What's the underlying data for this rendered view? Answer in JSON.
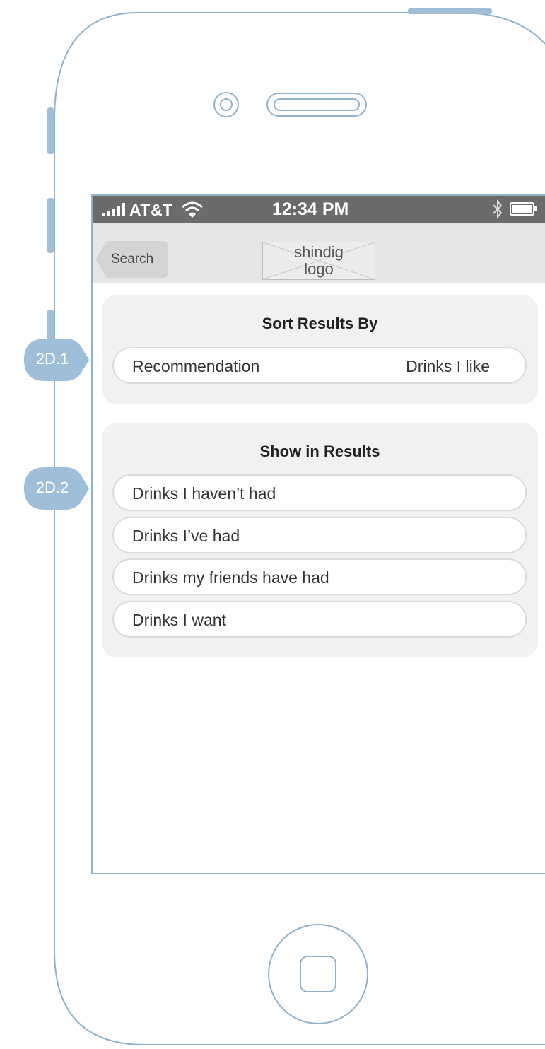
{
  "status_bar": {
    "carrier": "AT&T",
    "time": "12:34 PM"
  },
  "nav": {
    "back_label": "Search",
    "logo_line1": "shindig",
    "logo_line2": "logo"
  },
  "sort_section": {
    "title": "Sort Results By",
    "option_left": "Recommendation",
    "option_right": "Drinks I like"
  },
  "show_section": {
    "title": "Show in Results",
    "items": [
      "Drinks I haven’t had",
      "Drinks I’ve had",
      "Drinks my friends have had",
      "Drinks I want"
    ]
  },
  "annotations": {
    "first": "2D.1",
    "second": "2D.2"
  },
  "colors": {
    "outline": "#8fb2cc",
    "badge": "#9ebfd7",
    "status_bar": "#6b6b6b",
    "nav_bar": "#e6e6e6",
    "group_bg": "#f0f1f1"
  },
  "icons": {
    "signal": "signal-bars-icon",
    "wifi": "wifi-icon",
    "bluetooth": "bluetooth-icon",
    "battery": "battery-icon",
    "camera": "front-camera-icon",
    "speaker": "speaker-slot-icon",
    "home": "home-button-icon"
  }
}
